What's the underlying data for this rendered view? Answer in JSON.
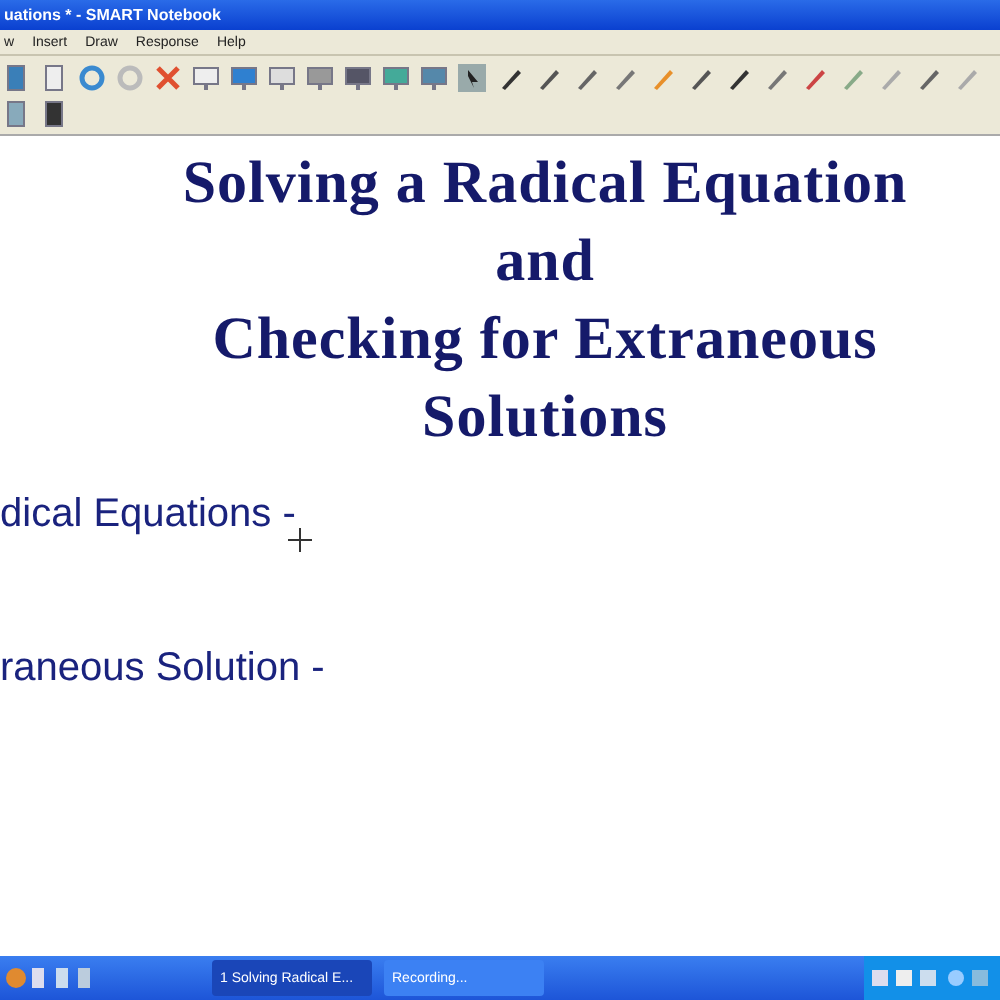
{
  "window": {
    "title": "uations * - SMART Notebook"
  },
  "menu": [
    "w",
    "Insert",
    "Draw",
    "Response",
    "Help"
  ],
  "page": {
    "heading": [
      "Solving a Radical Equation",
      "and",
      "Checking for Extraneous",
      "Solutions"
    ],
    "notes": [
      "dical Equations -",
      "raneous Solution -"
    ]
  },
  "taskbar": {
    "tasks": [
      {
        "label": "1 Solving Radical E...",
        "selected": true
      },
      {
        "label": "Recording...",
        "selected": false
      }
    ]
  }
}
